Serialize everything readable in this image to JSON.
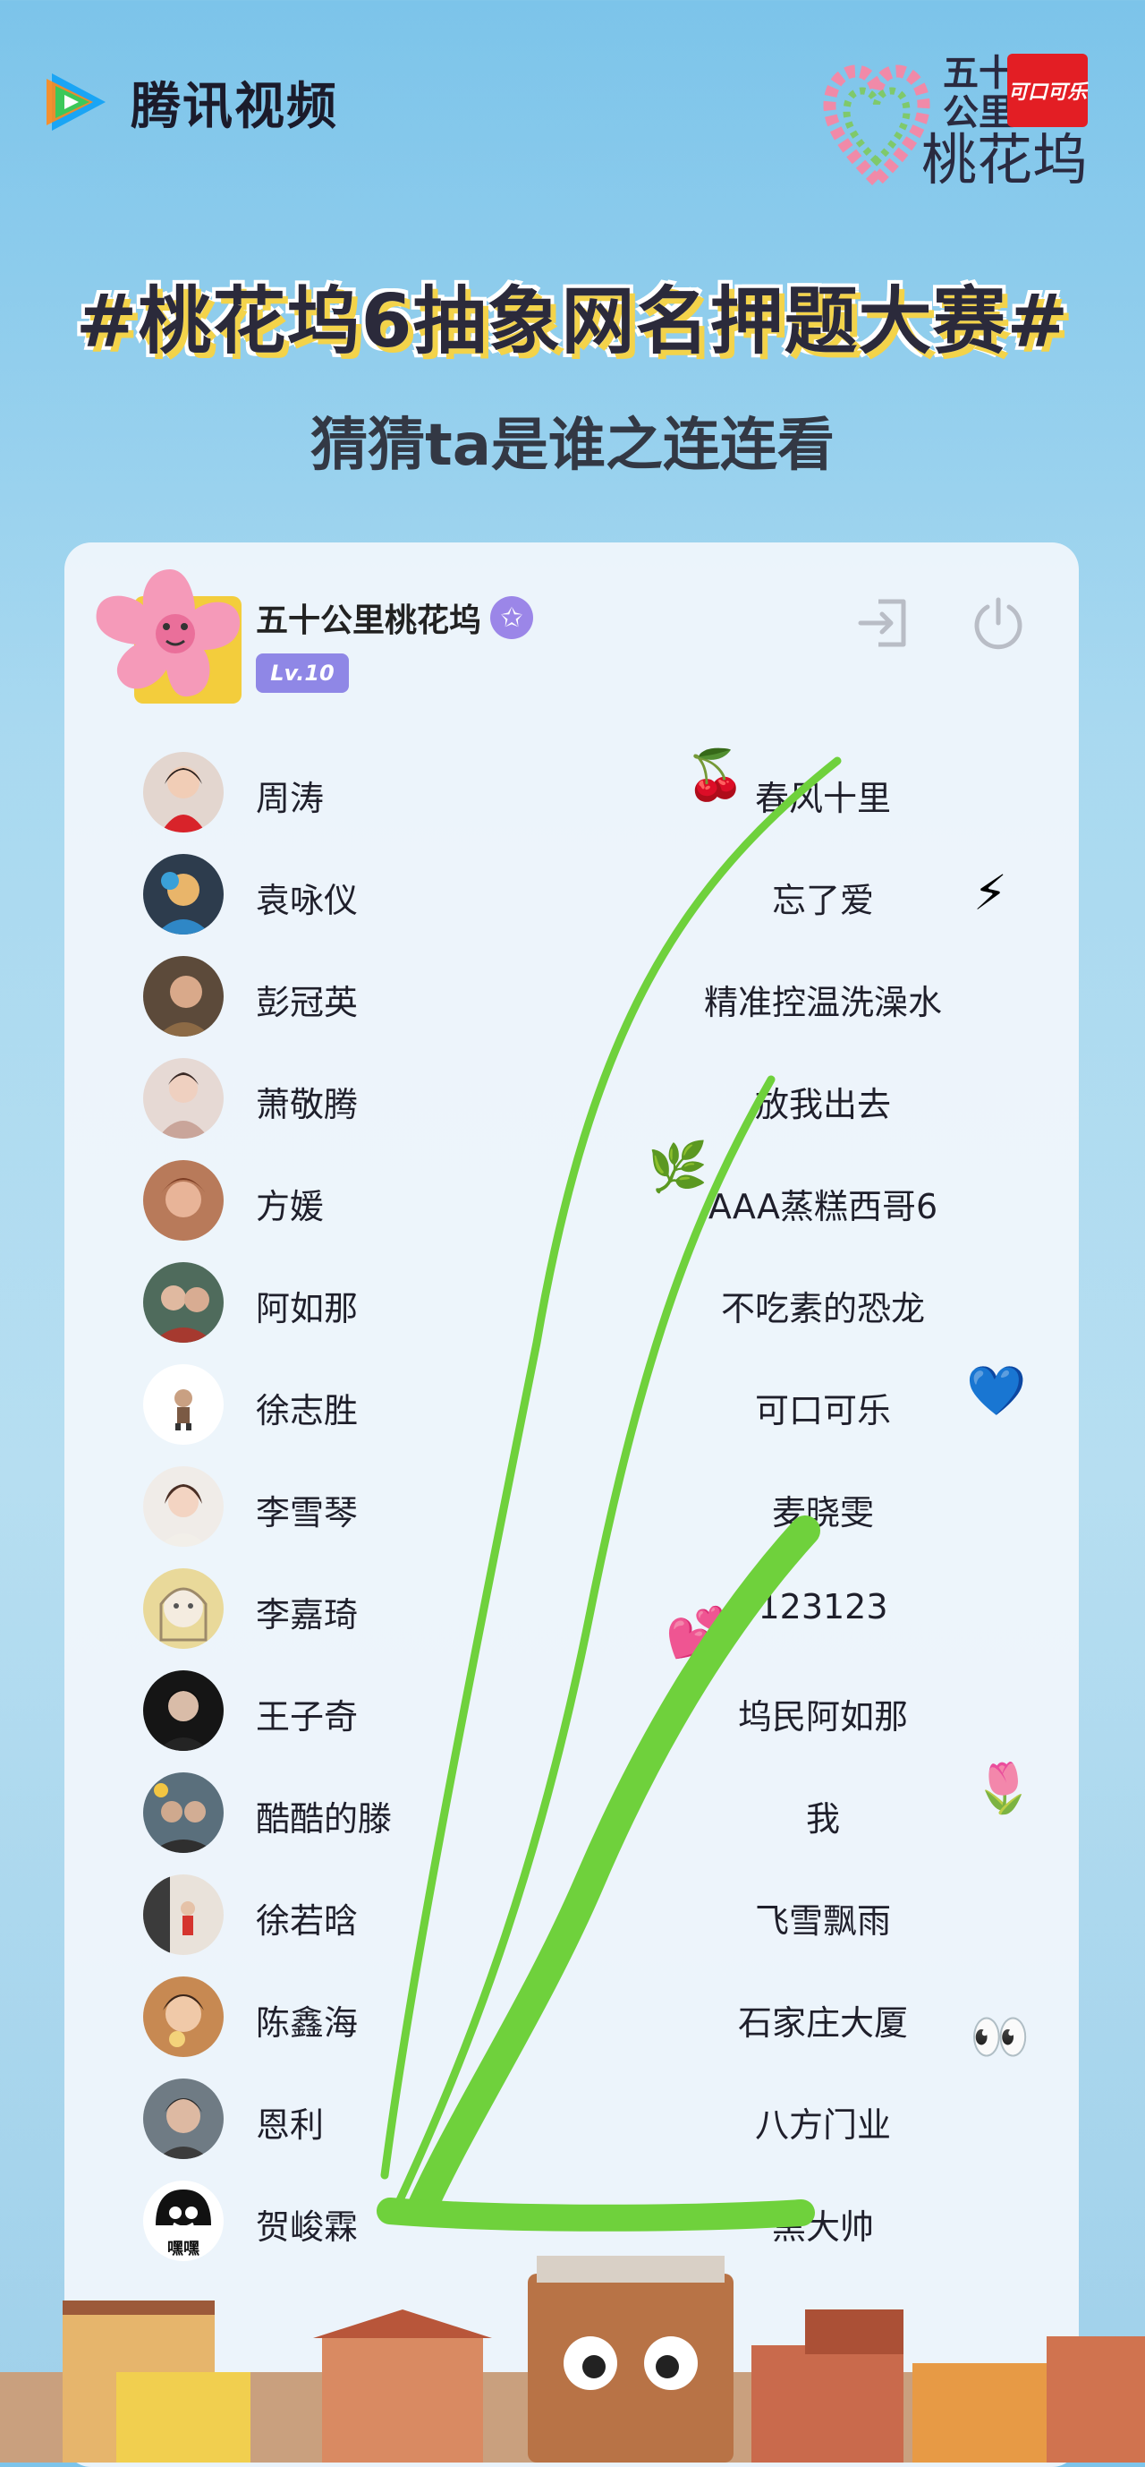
{
  "header": {
    "app_name": "腾讯视频",
    "brand_line1": "五十",
    "brand_line1b": "公里",
    "brand_line2": "桃花坞",
    "coke": "可口可乐",
    "title": "#桃花坞6抽象网名押题大赛#",
    "subtitle": "猜猜ta是谁之连连看"
  },
  "profile": {
    "name": "五十公里桃花坞",
    "level": "Lv.10"
  },
  "colors": {
    "accent_green": "#6fd13c",
    "level_purple": "#8f87e6",
    "title_yellow": "#f3d34a"
  },
  "left_names": [
    "周涛",
    "袁咏仪",
    "彭冠英",
    "萧敬腾",
    "方媛",
    "阿如那",
    "徐志胜",
    "李雪琴",
    "李嘉琦",
    "王子奇",
    "酷酷的滕",
    "徐若晗",
    "陈鑫海",
    "恩利",
    "贺峻霖"
  ],
  "right_names": [
    "春风十里",
    "忘了爱",
    "精准控温洗澡水",
    "放我出去",
    "AAA蒸糕西哥6",
    "不吃素的恐龙",
    "可口可乐",
    "麦晓雯",
    "123123",
    "坞民阿如那",
    "我",
    "飞雪飘雨",
    "石家庄大厦",
    "八方门业",
    "黑大帅"
  ],
  "avatar_caption": "嘿嘿",
  "emojis": [
    "🍒",
    "⚡",
    "🌿",
    "💙",
    "💕",
    "🌷",
    "👀"
  ]
}
